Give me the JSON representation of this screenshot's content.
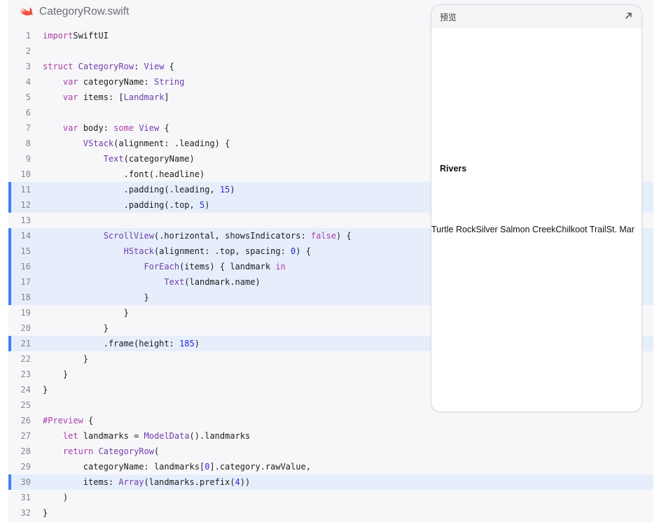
{
  "file": {
    "name": "CategoryRow.swift",
    "icon": "swift-icon"
  },
  "colors": {
    "editor_bg": "#f7f7fa",
    "highlight_bg": "#e6eefb",
    "highlight_bar": "#3b82f6",
    "keyword": "#ad3da4",
    "type": "#703daa",
    "number": "#272ad8",
    "swift_orange": "#f05138"
  },
  "code": {
    "highlighted_lines": [
      11,
      12,
      14,
      15,
      16,
      17,
      18,
      21,
      30
    ],
    "lines": [
      {
        "n": "1",
        "t": [
          [
            "kw",
            "import"
          ],
          [
            "",
            "SwiftUI"
          ]
        ]
      },
      {
        "n": "2",
        "t": []
      },
      {
        "n": "3",
        "t": [
          [
            "kw",
            "struct"
          ],
          [
            "",
            " "
          ],
          [
            "ty",
            "CategoryRow"
          ],
          [
            "",
            ": "
          ],
          [
            "ty",
            "View"
          ],
          [
            "",
            " {"
          ]
        ]
      },
      {
        "n": "4",
        "t": [
          [
            "",
            "    "
          ],
          [
            "kw",
            "var"
          ],
          [
            "",
            " categoryName: "
          ],
          [
            "ty",
            "String"
          ]
        ]
      },
      {
        "n": "5",
        "t": [
          [
            "",
            "    "
          ],
          [
            "kw",
            "var"
          ],
          [
            "",
            " items: ["
          ],
          [
            "ty",
            "Landmark"
          ],
          [
            "",
            "]"
          ]
        ]
      },
      {
        "n": "6",
        "t": []
      },
      {
        "n": "7",
        "t": [
          [
            "",
            "    "
          ],
          [
            "kw",
            "var"
          ],
          [
            "",
            " body: "
          ],
          [
            "kw",
            "some"
          ],
          [
            "",
            " "
          ],
          [
            "ty",
            "View"
          ],
          [
            "",
            " {"
          ]
        ]
      },
      {
        "n": "8",
        "t": [
          [
            "",
            "        "
          ],
          [
            "ty",
            "VStack"
          ],
          [
            "",
            "(alignment: .leading) {"
          ]
        ]
      },
      {
        "n": "9",
        "t": [
          [
            "",
            "            "
          ],
          [
            "ty",
            "Text"
          ],
          [
            "",
            "(categoryName)"
          ]
        ]
      },
      {
        "n": "10",
        "t": [
          [
            "",
            "                .font(.headline)"
          ]
        ]
      },
      {
        "n": "11",
        "t": [
          [
            "",
            "                .padding(.leading, "
          ],
          [
            "num",
            "15"
          ],
          [
            "",
            ")"
          ]
        ]
      },
      {
        "n": "12",
        "t": [
          [
            "",
            "                .padding(.top, "
          ],
          [
            "num",
            "5"
          ],
          [
            "",
            ")"
          ]
        ]
      },
      {
        "n": "13",
        "t": []
      },
      {
        "n": "14",
        "t": [
          [
            "",
            "            "
          ],
          [
            "ty",
            "ScrollView"
          ],
          [
            "",
            "(.horizontal, showsIndicators: "
          ],
          [
            "kw",
            "false"
          ],
          [
            "",
            ") {"
          ]
        ]
      },
      {
        "n": "15",
        "t": [
          [
            "",
            "                "
          ],
          [
            "ty",
            "HStack"
          ],
          [
            "",
            "(alignment: .top, spacing: "
          ],
          [
            "num",
            "0"
          ],
          [
            "",
            ") {"
          ]
        ]
      },
      {
        "n": "16",
        "t": [
          [
            "",
            "                    "
          ],
          [
            "ty",
            "ForEach"
          ],
          [
            "",
            "(items) { landmark "
          ],
          [
            "kw",
            "in"
          ]
        ]
      },
      {
        "n": "17",
        "t": [
          [
            "",
            "                        "
          ],
          [
            "ty",
            "Text"
          ],
          [
            "",
            "(landmark.name)"
          ]
        ]
      },
      {
        "n": "18",
        "t": [
          [
            "",
            "                    }"
          ]
        ]
      },
      {
        "n": "19",
        "t": [
          [
            "",
            "                }"
          ]
        ]
      },
      {
        "n": "20",
        "t": [
          [
            "",
            "            }"
          ]
        ]
      },
      {
        "n": "21",
        "t": [
          [
            "",
            "            .frame(height: "
          ],
          [
            "num",
            "185"
          ],
          [
            "",
            ")"
          ]
        ]
      },
      {
        "n": "22",
        "t": [
          [
            "",
            "        }"
          ]
        ]
      },
      {
        "n": "23",
        "t": [
          [
            "",
            "    }"
          ]
        ]
      },
      {
        "n": "24",
        "t": [
          [
            "",
            "}"
          ]
        ]
      },
      {
        "n": "25",
        "t": []
      },
      {
        "n": "26",
        "t": [
          [
            "kw",
            "#Preview"
          ],
          [
            "",
            " {"
          ]
        ]
      },
      {
        "n": "27",
        "t": [
          [
            "",
            "    "
          ],
          [
            "kw",
            "let"
          ],
          [
            "",
            " landmarks = "
          ],
          [
            "ty",
            "ModelData"
          ],
          [
            "",
            "().landmarks"
          ]
        ]
      },
      {
        "n": "28",
        "t": [
          [
            "",
            "    "
          ],
          [
            "kw",
            "return"
          ],
          [
            "",
            " "
          ],
          [
            "ty",
            "CategoryRow"
          ],
          [
            "",
            "("
          ]
        ]
      },
      {
        "n": "29",
        "t": [
          [
            "",
            "        categoryName: landmarks["
          ],
          [
            "num",
            "0"
          ],
          [
            "",
            "].category.rawValue,"
          ]
        ]
      },
      {
        "n": "30",
        "t": [
          [
            "",
            "        items: "
          ],
          [
            "ty",
            "Array"
          ],
          [
            "",
            "(landmarks.prefix("
          ],
          [
            "num",
            "4"
          ],
          [
            "",
            "))"
          ]
        ]
      },
      {
        "n": "31",
        "t": [
          [
            "",
            "    )"
          ]
        ]
      },
      {
        "n": "32",
        "t": [
          [
            "",
            "}"
          ]
        ]
      }
    ]
  },
  "preview": {
    "title": "预览",
    "expand_icon": "expand-arrow-icon",
    "category_heading": "Rivers",
    "items": [
      "Turtle Rock",
      "Silver Salmon Creek",
      "Chilkoot Trail",
      "St. Mar"
    ]
  }
}
